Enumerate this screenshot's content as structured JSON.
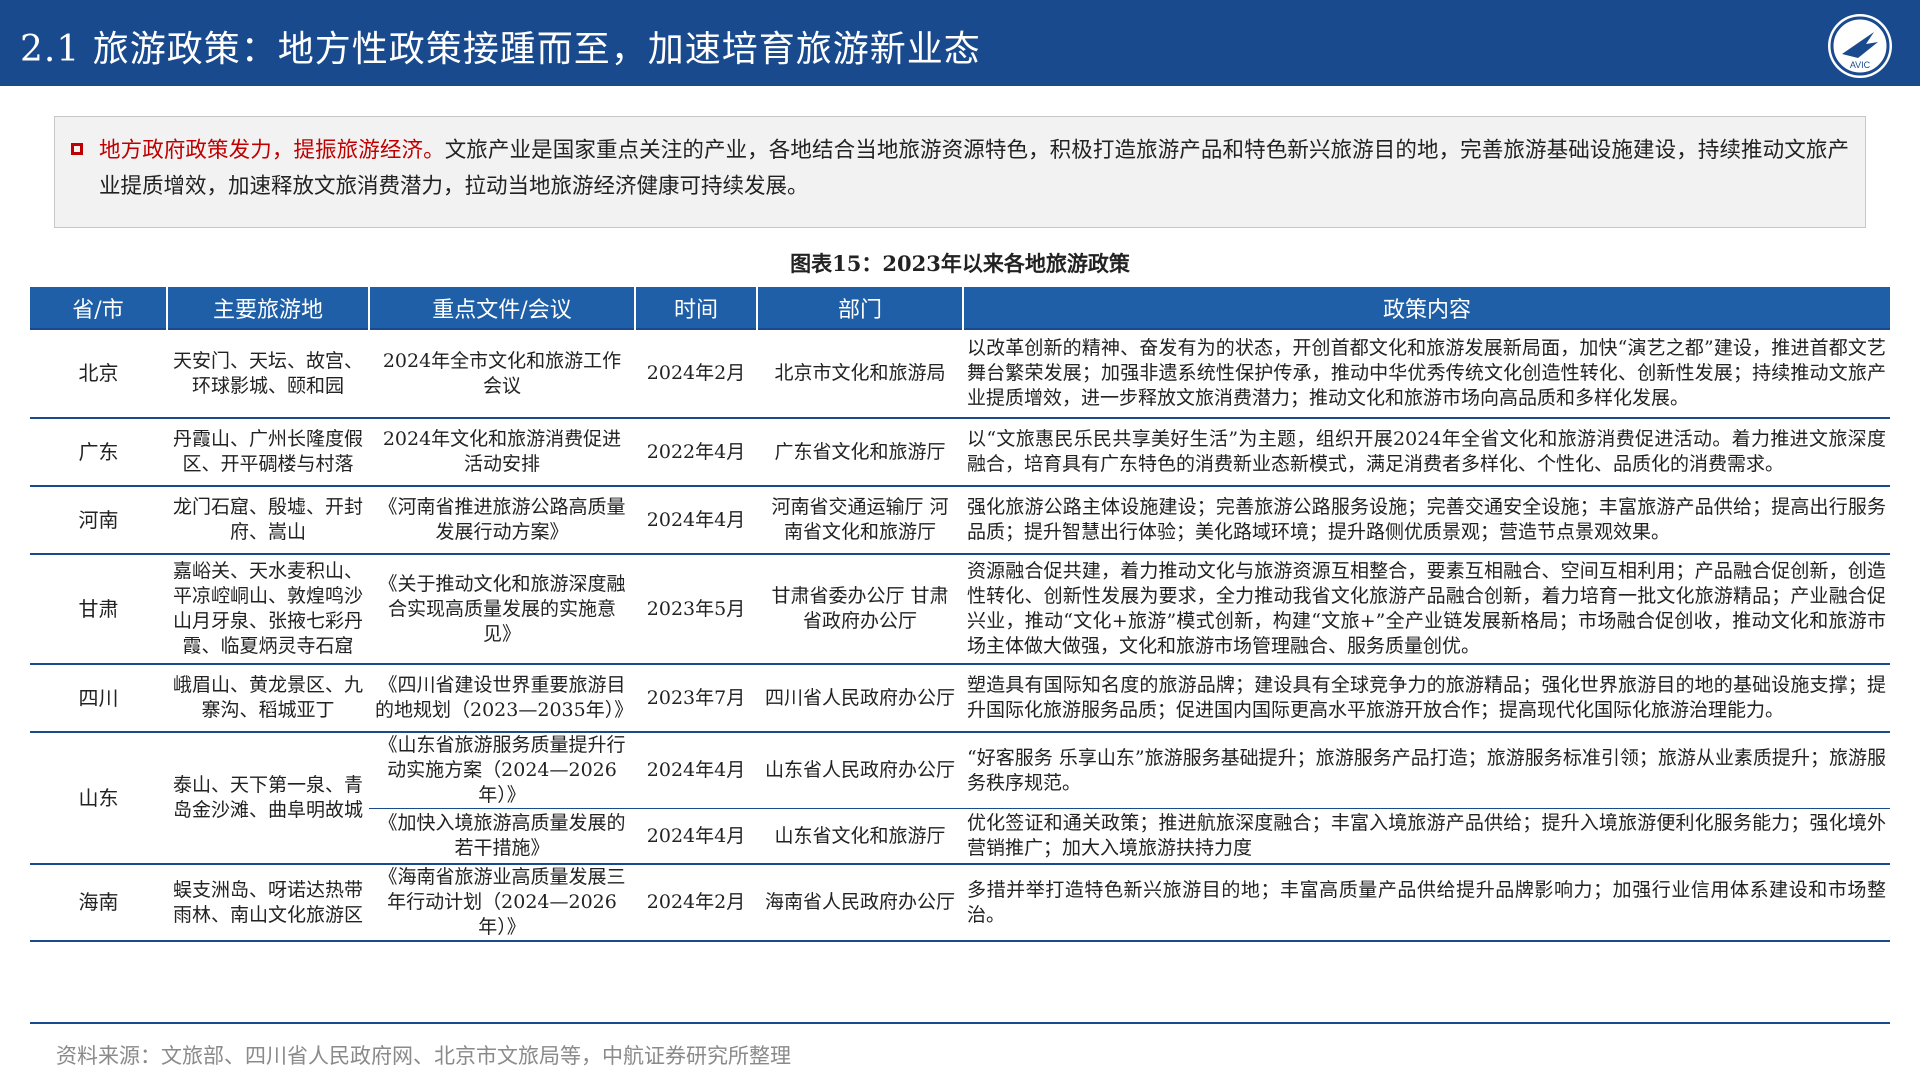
{
  "header": {
    "title": "2.1 旅游政策：地方性政策接踵而至，加速培育旅游新业态",
    "logo_text": "AVIC",
    "colors": {
      "bar": "#1a4a8e",
      "accent": "#c00000"
    }
  },
  "summary": {
    "lead": "地方政府政策发力，提振旅游经济。",
    "body": "文旅产业是国家重点关注的产业，各地结合当地旅游资源特色，积极打造旅游产品和特色新兴旅游目的地，完善旅游基础设施建设，持续推动文旅产业提质增效，加速释放文旅消费潜力，拉动当地旅游经济健康可持续发展。"
  },
  "table": {
    "caption": "图表15：2023年以来各地旅游政策",
    "headers": [
      "省/市",
      "主要旅游地",
      "重点文件/会议",
      "时间",
      "部门",
      "政策内容"
    ],
    "rows": [
      {
        "province": "北京",
        "sites": "天安门、天坛、故宫、环球影城、颐和园",
        "doc": "2024年全市文化和旅游工作会议",
        "time": "2024年2月",
        "dept": "北京市文化和旅游局",
        "content": "以改革创新的精神、奋发有为的状态，开创首都文化和旅游发展新局面，加快“演艺之都”建设，推进首都文艺舞台繁荣发展；加强非遗系统性保护传承，推动中华优秀传统文化创造性转化、创新性发展；持续推动文旅产业提质增效，进一步释放文旅消费潜力；推动文化和旅游市场向高品质和多样化发展。"
      },
      {
        "province": "广东",
        "sites": "丹霞山、广州长隆度假区、开平碉楼与村落",
        "doc": "2024年文化和旅游消费促进活动安排",
        "time": "2022年4月",
        "dept": "广东省文化和旅游厅",
        "content": "以“文旅惠民乐民共享美好生活”为主题，组织开展2024年全省文化和旅游消费促进活动。着力推进文旅深度融合，培育具有广东特色的消费新业态新模式，满足消费者多样化、个性化、品质化的消费需求。"
      },
      {
        "province": "河南",
        "sites": "龙门石窟、殷墟、开封府、嵩山",
        "doc": "《河南省推进旅游公路高质量发展行动方案》",
        "time": "2024年4月",
        "dept": "河南省交通运输厅 河南省文化和旅游厅",
        "content": "强化旅游公路主体设施建设；完善旅游公路服务设施；完善交通安全设施；丰富旅游产品供给；提高出行服务品质；提升智慧出行体验；美化路域环境；提升路侧优质景观；营造节点景观效果。"
      },
      {
        "province": "甘肃",
        "sites": "嘉峪关、天水麦积山、平凉崆峒山、敦煌鸣沙山月牙泉、张掖七彩丹霞、临夏炳灵寺石窟",
        "doc": "《关于推动文化和旅游深度融合实现高质量发展的实施意见》",
        "time": "2023年5月",
        "dept": "甘肃省委办公厅 甘肃省政府办公厅",
        "content": "资源融合促共建，着力推动文化与旅游资源互相整合，要素互相融合、空间互相利用；产品融合促创新，创造性转化、创新性发展为要求，全力推动我省文化旅游产品融合创新，着力培育一批文化旅游精品；产业融合促兴业，推动“文化+旅游”模式创新，构建“文旅+”全产业链发展新格局；市场融合促创收，推动文化和旅游市场主体做大做强，文化和旅游市场管理融合、服务质量创优。"
      },
      {
        "province": "四川",
        "sites": "峨眉山、黄龙景区、九寨沟、稻城亚丁",
        "doc": "《四川省建设世界重要旅游目的地规划（2023—2035年）》",
        "time": "2023年7月",
        "dept": "四川省人民政府办公厅",
        "content": "塑造具有国际知名度的旅游品牌；建设具有全球竞争力的旅游精品；强化世界旅游目的地的基础设施支撑；提升国际化旅游服务品质；促进国内国际更高水平旅游开放合作；提高现代化国际化旅游治理能力。"
      },
      {
        "province": "山东",
        "sites": "泰山、天下第一泉、青岛金沙滩、曲阜明故城",
        "doc": "《山东省旅游服务质量提升行动实施方案（2024—2026年）》",
        "time": "2024年4月",
        "dept": "山东省人民政府办公厅",
        "content": "“好客服务 乐享山东”旅游服务基础提升；旅游服务产品打造；旅游服务标准引领；旅游从业素质提升；旅游服务秩序规范。"
      },
      {
        "doc": "《加快入境旅游高质量发展的若干措施》",
        "time": "2024年4月",
        "dept": "山东省文化和旅游厅",
        "content": "优化签证和通关政策；推进航旅深度融合；丰富入境旅游产品供给；提升入境旅游便利化服务能力；强化境外营销推广；加大入境旅游扶持力度"
      },
      {
        "province": "海南",
        "sites": "蜈支洲岛、呀诺达热带雨林、南山文化旅游区",
        "doc": "《海南省旅游业高质量发展三年行动计划（2024—2026年）》",
        "time": "2024年2月",
        "dept": "海南省人民政府办公厅",
        "content": "多措并举打造特色新兴旅游目的地；丰富高质量产品供给提升品牌影响力；加强行业信用体系建设和市场整治。"
      }
    ]
  },
  "source": "资料来源：文旅部、四川省人民政府网、北京市文旅局等，中航证券研究所整理"
}
